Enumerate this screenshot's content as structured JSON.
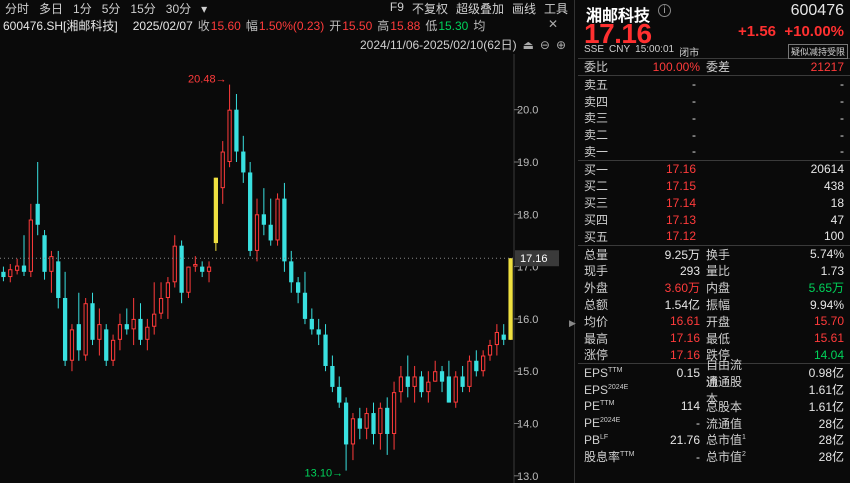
{
  "toolbar": {
    "items": [
      "分时",
      "多日",
      "1分",
      "5分",
      "15分",
      "30分",
      "▾"
    ],
    "right": [
      "F9",
      "不复权",
      "超级叠加",
      "画线",
      "工具"
    ]
  },
  "info": {
    "symbol": "600476.SH[湘邮科技]",
    "date": "2025/02/07",
    "close_label": "收",
    "close": "15.60",
    "amp_label": "幅",
    "amp": "1.50%(0.23)",
    "open_label": "开",
    "open": "15.50",
    "high_label": "高",
    "high": "15.88",
    "low_label": "低",
    "low": "15.30",
    "avg_label": "均"
  },
  "range": {
    "text": "2024/11/06-2025/02/10(62日)"
  },
  "chart_data": {
    "type": "candlestick",
    "title": "",
    "y_ticks": [
      "20.0",
      "19.0",
      "18.0",
      "17.0",
      "16.0",
      "15.0",
      "14.0",
      "13.0"
    ],
    "ylim": [
      12.92,
      20.95
    ],
    "last_price": "17.16",
    "max_label": "20.48→",
    "min_label": "13.10→",
    "colors": {
      "up": "#ff3b3b",
      "down": "#39e0e0",
      "limit": "#f0e040"
    },
    "candles": [
      {
        "o": 16.9,
        "h": 17.0,
        "l": 16.72,
        "c": 16.8
      },
      {
        "o": 16.8,
        "h": 17.05,
        "l": 16.7,
        "c": 16.95
      },
      {
        "o": 16.92,
        "h": 17.15,
        "l": 16.85,
        "c": 17.02
      },
      {
        "o": 17.02,
        "h": 17.6,
        "l": 16.82,
        "c": 16.9
      },
      {
        "o": 16.9,
        "h": 18.2,
        "l": 16.8,
        "c": 17.9
      },
      {
        "o": 18.2,
        "h": 19.0,
        "l": 17.6,
        "c": 17.8
      },
      {
        "o": 17.6,
        "h": 17.7,
        "l": 16.75,
        "c": 16.9
      },
      {
        "o": 16.9,
        "h": 17.3,
        "l": 16.5,
        "c": 17.2
      },
      {
        "o": 17.1,
        "h": 17.3,
        "l": 16.2,
        "c": 16.4
      },
      {
        "o": 16.4,
        "h": 16.9,
        "l": 15.1,
        "c": 15.2
      },
      {
        "o": 15.2,
        "h": 15.9,
        "l": 15.0,
        "c": 15.8
      },
      {
        "o": 15.9,
        "h": 16.5,
        "l": 15.2,
        "c": 15.4
      },
      {
        "o": 15.3,
        "h": 16.4,
        "l": 15.2,
        "c": 16.3
      },
      {
        "o": 16.3,
        "h": 16.5,
        "l": 15.5,
        "c": 15.6
      },
      {
        "o": 15.6,
        "h": 16.2,
        "l": 15.3,
        "c": 15.9
      },
      {
        "o": 15.8,
        "h": 15.9,
        "l": 15.1,
        "c": 15.2
      },
      {
        "o": 15.2,
        "h": 15.7,
        "l": 15.1,
        "c": 15.6
      },
      {
        "o": 15.6,
        "h": 16.1,
        "l": 15.4,
        "c": 15.9
      },
      {
        "o": 15.9,
        "h": 16.2,
        "l": 15.7,
        "c": 15.8
      },
      {
        "o": 15.8,
        "h": 16.4,
        "l": 15.5,
        "c": 16.0
      },
      {
        "o": 16.0,
        "h": 16.3,
        "l": 15.5,
        "c": 15.6
      },
      {
        "o": 15.6,
        "h": 16.0,
        "l": 15.4,
        "c": 15.85
      },
      {
        "o": 15.85,
        "h": 16.7,
        "l": 15.7,
        "c": 16.1
      },
      {
        "o": 16.1,
        "h": 16.7,
        "l": 16.0,
        "c": 16.4
      },
      {
        "o": 16.4,
        "h": 16.8,
        "l": 16.0,
        "c": 16.7
      },
      {
        "o": 16.7,
        "h": 17.6,
        "l": 16.6,
        "c": 17.4
      },
      {
        "o": 17.4,
        "h": 17.5,
        "l": 16.3,
        "c": 16.5
      },
      {
        "o": 16.5,
        "h": 17.0,
        "l": 16.4,
        "c": 17.0
      },
      {
        "o": 17.0,
        "h": 17.2,
        "l": 16.9,
        "c": 17.05
      },
      {
        "o": 17.0,
        "h": 17.1,
        "l": 16.8,
        "c": 16.9
      },
      {
        "o": 16.9,
        "h": 17.1,
        "l": 16.7,
        "c": 17.0
      },
      {
        "o": 17.45,
        "h": 18.7,
        "l": 17.3,
        "c": 18.7,
        "limit": true
      },
      {
        "o": 18.5,
        "h": 19.4,
        "l": 18.2,
        "c": 19.2
      },
      {
        "o": 19.0,
        "h": 20.48,
        "l": 18.9,
        "c": 20.0
      },
      {
        "o": 20.0,
        "h": 20.3,
        "l": 19.0,
        "c": 19.2
      },
      {
        "o": 19.2,
        "h": 19.5,
        "l": 18.6,
        "c": 18.8
      },
      {
        "o": 18.8,
        "h": 19.0,
        "l": 17.2,
        "c": 17.3
      },
      {
        "o": 17.3,
        "h": 18.3,
        "l": 17.1,
        "c": 18.0
      },
      {
        "o": 18.0,
        "h": 18.5,
        "l": 17.6,
        "c": 17.8
      },
      {
        "o": 17.8,
        "h": 18.3,
        "l": 17.4,
        "c": 17.5
      },
      {
        "o": 17.5,
        "h": 18.4,
        "l": 17.4,
        "c": 18.3
      },
      {
        "o": 18.3,
        "h": 18.6,
        "l": 16.9,
        "c": 17.1
      },
      {
        "o": 17.1,
        "h": 17.3,
        "l": 16.5,
        "c": 16.7
      },
      {
        "o": 16.7,
        "h": 16.8,
        "l": 16.3,
        "c": 16.5
      },
      {
        "o": 16.5,
        "h": 16.9,
        "l": 15.9,
        "c": 16.0
      },
      {
        "o": 16.0,
        "h": 16.2,
        "l": 15.7,
        "c": 15.8
      },
      {
        "o": 15.8,
        "h": 16.0,
        "l": 15.5,
        "c": 15.7
      },
      {
        "o": 15.7,
        "h": 15.9,
        "l": 15.0,
        "c": 15.1
      },
      {
        "o": 15.1,
        "h": 15.3,
        "l": 14.6,
        "c": 14.7
      },
      {
        "o": 14.7,
        "h": 14.9,
        "l": 14.3,
        "c": 14.4
      },
      {
        "o": 14.4,
        "h": 14.5,
        "l": 13.1,
        "c": 13.6
      },
      {
        "o": 13.6,
        "h": 14.2,
        "l": 13.3,
        "c": 14.1
      },
      {
        "o": 14.1,
        "h": 14.3,
        "l": 13.7,
        "c": 13.9
      },
      {
        "o": 13.9,
        "h": 14.3,
        "l": 13.7,
        "c": 14.2
      },
      {
        "o": 14.2,
        "h": 14.4,
        "l": 13.6,
        "c": 13.8
      },
      {
        "o": 13.8,
        "h": 14.4,
        "l": 13.5,
        "c": 14.3
      },
      {
        "o": 14.3,
        "h": 14.5,
        "l": 13.4,
        "c": 13.8
      },
      {
        "o": 13.8,
        "h": 14.8,
        "l": 13.5,
        "c": 14.6
      },
      {
        "o": 14.6,
        "h": 15.1,
        "l": 14.4,
        "c": 14.9
      },
      {
        "o": 14.9,
        "h": 15.3,
        "l": 14.5,
        "c": 14.7
      },
      {
        "o": 14.7,
        "h": 15.1,
        "l": 14.4,
        "c": 14.9
      },
      {
        "o": 14.9,
        "h": 15.0,
        "l": 14.5,
        "c": 14.6
      },
      {
        "o": 14.6,
        "h": 15.0,
        "l": 14.4,
        "c": 14.8
      },
      {
        "o": 14.8,
        "h": 15.2,
        "l": 14.8,
        "c": 15.0
      },
      {
        "o": 15.0,
        "h": 15.1,
        "l": 14.6,
        "c": 14.8
      },
      {
        "o": 14.9,
        "h": 15.2,
        "l": 14.4,
        "c": 14.4
      },
      {
        "o": 14.4,
        "h": 15.0,
        "l": 14.3,
        "c": 14.9
      },
      {
        "o": 14.9,
        "h": 15.1,
        "l": 14.6,
        "c": 14.7
      },
      {
        "o": 14.7,
        "h": 15.3,
        "l": 14.6,
        "c": 15.2
      },
      {
        "o": 15.2,
        "h": 15.4,
        "l": 14.9,
        "c": 15.0
      },
      {
        "o": 15.0,
        "h": 15.4,
        "l": 14.9,
        "c": 15.3
      },
      {
        "o": 15.3,
        "h": 15.6,
        "l": 15.2,
        "c": 15.5
      },
      {
        "o": 15.5,
        "h": 15.9,
        "l": 15.3,
        "c": 15.75
      },
      {
        "o": 15.7,
        "h": 15.9,
        "l": 15.5,
        "c": 15.6
      },
      {
        "o": 15.6,
        "h": 17.16,
        "l": 15.6,
        "c": 17.16,
        "limit": true
      }
    ]
  },
  "panel": {
    "name": "湘邮科技",
    "info_icon": "info-circle-icon",
    "code": "600476",
    "price": "17.16",
    "change": "+1.56",
    "pct": "+10.00%",
    "meta": [
      "SSE",
      "CNY",
      "15:00:01",
      "闭市"
    ],
    "tag": "疑似减持受限",
    "weibi": {
      "label": "委比",
      "value": "100.00%",
      "label2": "委差",
      "value2": "21217"
    },
    "asks": [
      {
        "l": "卖五",
        "p": "-",
        "v": "-"
      },
      {
        "l": "卖四",
        "p": "-",
        "v": "-"
      },
      {
        "l": "卖三",
        "p": "-",
        "v": "-"
      },
      {
        "l": "卖二",
        "p": "-",
        "v": "-"
      },
      {
        "l": "卖一",
        "p": "-",
        "v": "-"
      }
    ],
    "bids": [
      {
        "l": "买一",
        "p": "17.16",
        "v": "20614"
      },
      {
        "l": "买二",
        "p": "17.15",
        "v": "438"
      },
      {
        "l": "买三",
        "p": "17.14",
        "v": "18"
      },
      {
        "l": "买四",
        "p": "17.13",
        "v": "47"
      },
      {
        "l": "买五",
        "p": "17.12",
        "v": "100"
      }
    ],
    "stats": [
      {
        "l1": "总量",
        "v1": "9.25万",
        "c1": "white",
        "l2": "换手",
        "v2": "5.74%",
        "c2": "white"
      },
      {
        "l1": "现手",
        "v1": "293",
        "c1": "white",
        "l2": "量比",
        "v2": "1.73",
        "c2": "white"
      },
      {
        "l1": "外盘",
        "v1": "3.60万",
        "c1": "red",
        "l2": "内盘",
        "v2": "5.65万",
        "c2": "green"
      },
      {
        "l1": "总额",
        "v1": "1.54亿",
        "c1": "white",
        "l2": "振幅",
        "v2": "9.94%",
        "c2": "white"
      },
      {
        "l1": "均价",
        "v1": "16.61",
        "c1": "red",
        "l2": "开盘",
        "v2": "15.70",
        "c2": "red"
      },
      {
        "l1": "最高",
        "v1": "17.16",
        "c1": "red",
        "l2": "最低",
        "v2": "15.61",
        "c2": "red"
      },
      {
        "l1": "涨停",
        "v1": "17.16",
        "c1": "red",
        "l2": "跌停",
        "v2": "14.04",
        "c2": "green"
      }
    ],
    "fund": [
      {
        "l1": "EPS",
        "s1": "TTM",
        "v1": "0.15",
        "l2": "自由流通",
        "v2": "0.98亿"
      },
      {
        "l1": "EPS",
        "s1": "2024E",
        "v1": "",
        "l2": "流通股本",
        "v2": "1.61亿"
      },
      {
        "l1": "PE",
        "s1": "TTM",
        "v1": "114",
        "l2": "总股本",
        "v2": "1.61亿"
      },
      {
        "l1": "PE",
        "s1": "2024E",
        "v1": "-",
        "l2": "流通值",
        "v2": "28亿"
      },
      {
        "l1": "PB",
        "s1": "LF",
        "v1": "21.76",
        "l2": "总市值",
        "s2": "1",
        "v2": "28亿"
      },
      {
        "l1": "股息率",
        "s1": "TTM",
        "v1": "-",
        "l2": "总市值",
        "s2": "2",
        "v2": "28亿"
      }
    ]
  }
}
